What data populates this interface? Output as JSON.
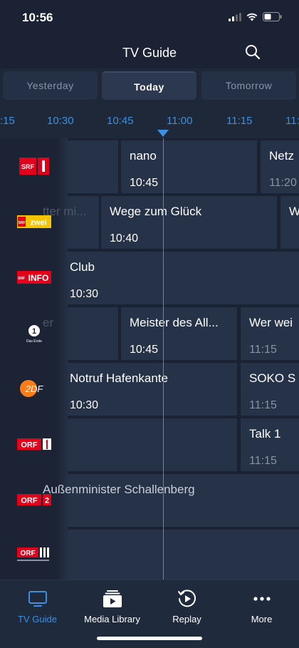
{
  "status_bar": {
    "time": "10:56"
  },
  "nav": {
    "title": "TV Guide",
    "search_icon": "search-icon"
  },
  "day_tabs": [
    {
      "label": "Yesterday",
      "active": false
    },
    {
      "label": "Today",
      "active": true
    },
    {
      "label": "Tomorrow",
      "active": false
    }
  ],
  "timeline": {
    "labels": [
      ":15",
      "10:30",
      "10:45",
      "11:00",
      "11:15",
      "11:"
    ],
    "now": "10:56"
  },
  "channels": [
    {
      "name": "SRF 1",
      "logo_text": "SRF 1"
    },
    {
      "name": "SRF zwei",
      "logo_text": "zwei"
    },
    {
      "name": "SRF info",
      "logo_text": "INFO"
    },
    {
      "name": "Das Erste",
      "logo_text": "Das Erste"
    },
    {
      "name": "ZDF",
      "logo_text": "2DF"
    },
    {
      "name": "ORF 1",
      "logo_text": "ORF"
    },
    {
      "name": "ORF 2",
      "logo_text": "ORF"
    },
    {
      "name": "ORF III",
      "logo_text": "ORF"
    }
  ],
  "programs": {
    "r0": [
      {
        "title": "",
        "time": ""
      },
      {
        "title": "nano",
        "time": "10:45"
      },
      {
        "title": "Netz",
        "time": "11:20"
      }
    ],
    "r1": [
      {
        "title": "tter mi...",
        "time": ""
      },
      {
        "title": "Wege zum Glück",
        "time": "10:40"
      },
      {
        "title": "W",
        "time": ""
      }
    ],
    "r2": [
      {
        "title": "Club",
        "time": "10:30"
      }
    ],
    "r3": [
      {
        "title": "er",
        "time": ""
      },
      {
        "title": "Meister des All...",
        "time": "10:45"
      },
      {
        "title": "Wer wei",
        "time": "11:15"
      }
    ],
    "r4": [
      {
        "title": "Notruf Hafenkante",
        "time": "10:30"
      },
      {
        "title": "SOKO S",
        "time": "11:15"
      }
    ],
    "r5": [
      {
        "title": "",
        "time": ""
      },
      {
        "title": "Talk 1",
        "time": "11:15"
      }
    ],
    "r6": [
      {
        "title": "Außenminister Schallenberg",
        "time": ""
      }
    ],
    "r7": [
      {
        "title": "",
        "time": ""
      }
    ]
  },
  "tab_bar": [
    {
      "label": "TV Guide",
      "icon": "tv-icon",
      "active": true
    },
    {
      "label": "Media Library",
      "icon": "media-library-icon",
      "active": false
    },
    {
      "label": "Replay",
      "icon": "replay-icon",
      "active": false
    },
    {
      "label": "More",
      "icon": "more-icon",
      "active": false
    }
  ],
  "colors": {
    "accent": "#3d8fe0",
    "background": "#1a2233",
    "cell": "#263247",
    "srf_red": "#e3001b",
    "zdf_orange": "#fa7d19",
    "orf_red": "#e3001b"
  }
}
